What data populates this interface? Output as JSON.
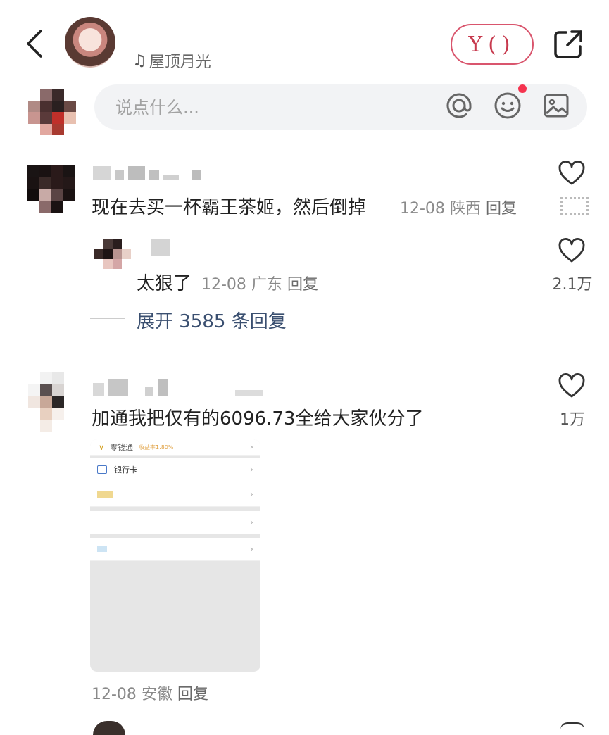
{
  "header": {
    "back_icon": "chevron-left-icon",
    "music_title": "屋顶月光",
    "stamp_text": "Y()",
    "share_icon": "share-icon"
  },
  "comment_input": {
    "placeholder": "说点什么..."
  },
  "comments": [
    {
      "text": "现在去买一杯霸王茶姬，然后倒掉",
      "date": "12-08",
      "location": "陕西",
      "reply_label": "回复",
      "reply": {
        "text": "太狠了",
        "date": "12-08",
        "location": "广东",
        "reply_label": "回复",
        "likes": "2.1万"
      },
      "expand_label": "展开 3585 条回复"
    },
    {
      "text": "加通我把仅有的6096.73全给大家伙分了",
      "likes": "1万",
      "date": "12-08",
      "location": "安徽",
      "reply_label": "回复",
      "image": {
        "row1_text": "零钱通",
        "row1_rate": "收益率1.80%",
        "row2_text": "银行卡"
      }
    }
  ],
  "colors": {
    "accent_link": "#3a4f70",
    "notification_dot": "#f5334f",
    "stamp": "#c73a4e"
  }
}
